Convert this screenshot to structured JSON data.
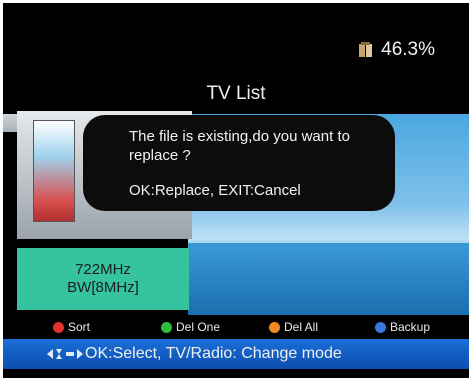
{
  "storage": {
    "percent": "46.3%"
  },
  "title": "TV List",
  "channel_info": {
    "frequency": "722MHz",
    "bandwidth": "BW[8MHz]"
  },
  "dialog": {
    "message": "The file is existing,do you want to replace ?",
    "options": "OK:Replace, EXIT:Cancel"
  },
  "buttons": [
    {
      "label": "Sort",
      "color": "#e23030"
    },
    {
      "label": "Del One",
      "color": "#2fbe3a"
    },
    {
      "label": "Del All",
      "color": "#f08a1e"
    },
    {
      "label": "Backup",
      "color": "#3a78e0"
    }
  ],
  "help_text": "OK:Select, TV/Radio: Change mode"
}
